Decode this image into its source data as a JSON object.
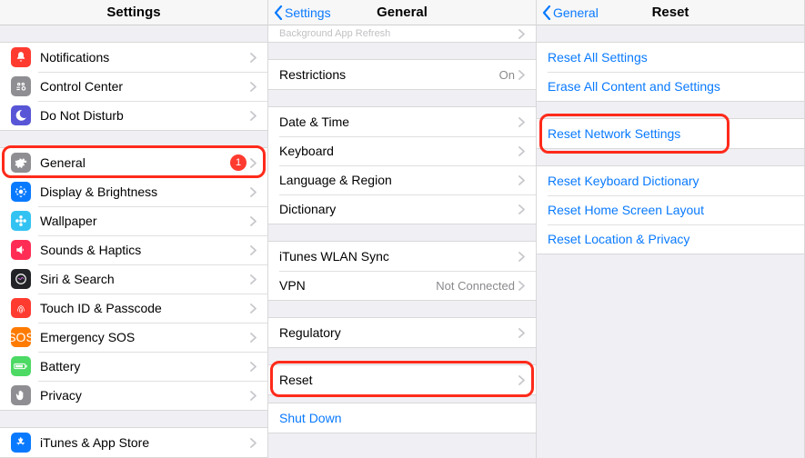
{
  "pane1": {
    "title": "Settings",
    "group1": [
      {
        "icon": "bell",
        "color": "#ff3b30",
        "label": "Notifications"
      },
      {
        "icon": "cc",
        "color": "#8e8e93",
        "label": "Control Center"
      },
      {
        "icon": "moon",
        "color": "#5856d6",
        "label": "Do Not Disturb"
      }
    ],
    "group2": [
      {
        "icon": "gear",
        "color": "#8e8e93",
        "label": "General",
        "badge": "1",
        "highlight": true
      },
      {
        "icon": "sun",
        "color": "#097aff",
        "label": "Display & Brightness"
      },
      {
        "icon": "flower",
        "color": "#33c3f2",
        "label": "Wallpaper"
      },
      {
        "icon": "speaker",
        "color": "#ff2d55",
        "label": "Sounds & Haptics"
      },
      {
        "icon": "siri",
        "color": "#222326",
        "label": "Siri & Search"
      },
      {
        "icon": "touchid",
        "color": "#ff3b30",
        "label": "Touch ID & Passcode"
      },
      {
        "icon": "sos",
        "color": "#ff7b00",
        "label": "Emergency SOS"
      },
      {
        "icon": "battery",
        "color": "#4cd964",
        "label": "Battery"
      },
      {
        "icon": "hand",
        "color": "#8e8e93",
        "label": "Privacy"
      }
    ],
    "group3": [
      {
        "icon": "appstore",
        "color": "#097aff",
        "label": "iTunes & App Store"
      }
    ]
  },
  "pane2": {
    "back": "Settings",
    "title": "General",
    "peek_label": "Background App Refresh",
    "group1": [
      {
        "label": "Restrictions",
        "detail": "On"
      }
    ],
    "group2": [
      {
        "label": "Date & Time"
      },
      {
        "label": "Keyboard"
      },
      {
        "label": "Language & Region"
      },
      {
        "label": "Dictionary"
      }
    ],
    "group3": [
      {
        "label": "iTunes WLAN Sync"
      },
      {
        "label": "VPN",
        "detail": "Not Connected"
      }
    ],
    "group4": [
      {
        "label": "Regulatory"
      }
    ],
    "group5": [
      {
        "label": "Reset",
        "highlight": true
      }
    ],
    "shutdown": "Shut Down"
  },
  "pane3": {
    "back": "General",
    "title": "Reset",
    "group1": [
      "Reset All Settings",
      "Erase All Content and Settings"
    ],
    "group2": [
      "Reset Network Settings"
    ],
    "group2_highlight": true,
    "group3": [
      "Reset Keyboard Dictionary",
      "Reset Home Screen Layout",
      "Reset Location & Privacy"
    ]
  }
}
